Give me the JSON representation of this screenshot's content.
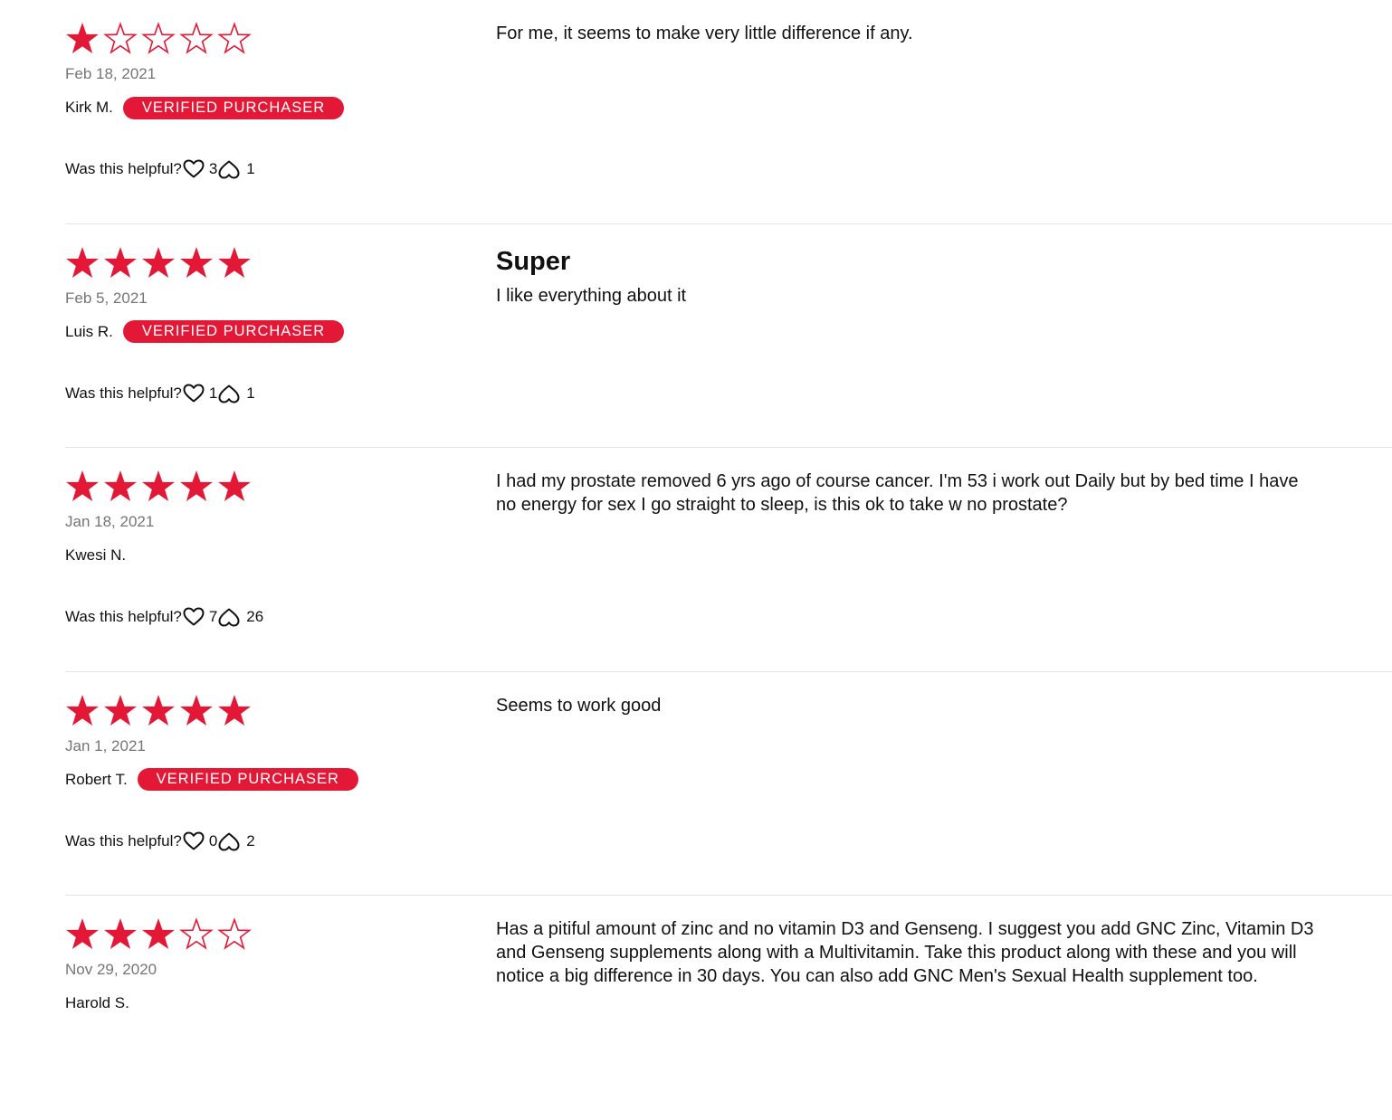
{
  "colors": {
    "accent": "#e31837",
    "date": "#757575",
    "divider": "#e3e3e3"
  },
  "helpful_label": "Was this helpful?",
  "reviews": [
    {
      "rating": 1,
      "date": "Feb 18, 2021",
      "author": "Kirk M.",
      "badge": "VERIFIED PURCHASER",
      "title": "",
      "body": "For me, it seems to make very little difference if any.",
      "helpful_yes": "3",
      "helpful_no": "1"
    },
    {
      "rating": 5,
      "date": "Feb 5, 2021",
      "author": "Luis R.",
      "badge": "VERIFIED PURCHASER",
      "title": "Super",
      "body": "I like everything about it",
      "helpful_yes": "1",
      "helpful_no": "1"
    },
    {
      "rating": 5,
      "date": "Jan 18, 2021",
      "author": "Kwesi N.",
      "badge": "",
      "title": "",
      "body": "I had my prostate removed 6 yrs ago of course cancer. I'm 53 i work out Daily but by bed time I have no energy for sex I go straight to sleep, is this ok to take w no prostate?",
      "helpful_yes": "7",
      "helpful_no": "26"
    },
    {
      "rating": 5,
      "date": "Jan 1, 2021",
      "author": "Robert T.",
      "badge": "VERIFIED PURCHASER",
      "title": "",
      "body": "Seems to work good",
      "helpful_yes": "0",
      "helpful_no": "2"
    },
    {
      "rating": 3,
      "date": "Nov 29, 2020",
      "author": "Harold S.",
      "badge": "",
      "title": "",
      "body": "Has a pitiful amount of zinc and no vitamin D3 and Genseng. I suggest you add GNC Zinc, Vitamin D3 and Genseng supplements along with a Multivitamin. Take this product along with these and you will notice a big difference in 30 days. You can also add GNC Men's Sexual Health supplement too.",
      "helpful_yes": "",
      "helpful_no": ""
    }
  ]
}
